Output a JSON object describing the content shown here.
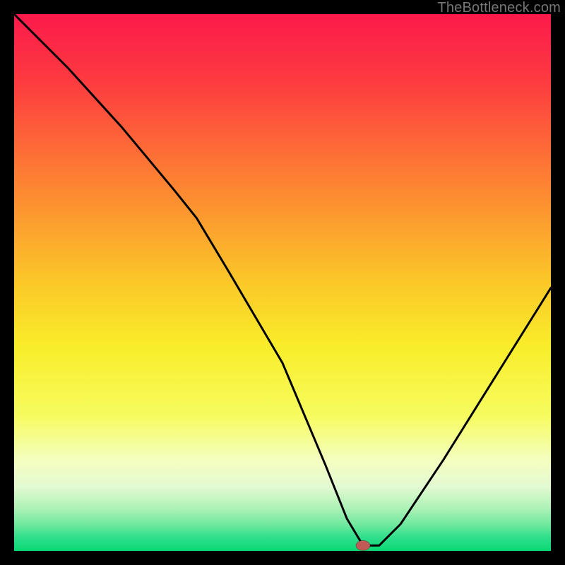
{
  "watermark": "TheBottleneck.com",
  "chart_data": {
    "type": "line",
    "title": "",
    "xlabel": "",
    "ylabel": "",
    "xlim": [
      0,
      100
    ],
    "ylim": [
      0,
      100
    ],
    "notes": "Bottleneck curve: y is mismatch % (0 = ideal). Min at x≈65. Background gradient: red (top) → yellow (mid) → green (bottom). Watermark top-right.",
    "x": [
      0,
      10,
      20,
      30,
      34,
      40,
      50,
      58,
      62,
      65,
      68,
      72,
      80,
      90,
      100
    ],
    "values": [
      100,
      90,
      79,
      67,
      62,
      52,
      35,
      16,
      6,
      1,
      1,
      5,
      17,
      33,
      49
    ],
    "marker": {
      "x": 65,
      "y": 1,
      "color": "#c05a57"
    },
    "gradient_stops": [
      {
        "pos": 0.0,
        "color": "#fb1a4b"
      },
      {
        "pos": 0.12,
        "color": "#fd3940"
      },
      {
        "pos": 0.3,
        "color": "#fd7d33"
      },
      {
        "pos": 0.5,
        "color": "#fbc828"
      },
      {
        "pos": 0.62,
        "color": "#f9ed2a"
      },
      {
        "pos": 0.75,
        "color": "#f6fc60"
      },
      {
        "pos": 0.83,
        "color": "#f4febf"
      },
      {
        "pos": 0.88,
        "color": "#e4fad2"
      },
      {
        "pos": 0.92,
        "color": "#aef2b7"
      },
      {
        "pos": 0.95,
        "color": "#72e9a0"
      },
      {
        "pos": 0.975,
        "color": "#2fdf8b"
      },
      {
        "pos": 1.0,
        "color": "#09d874"
      }
    ]
  }
}
